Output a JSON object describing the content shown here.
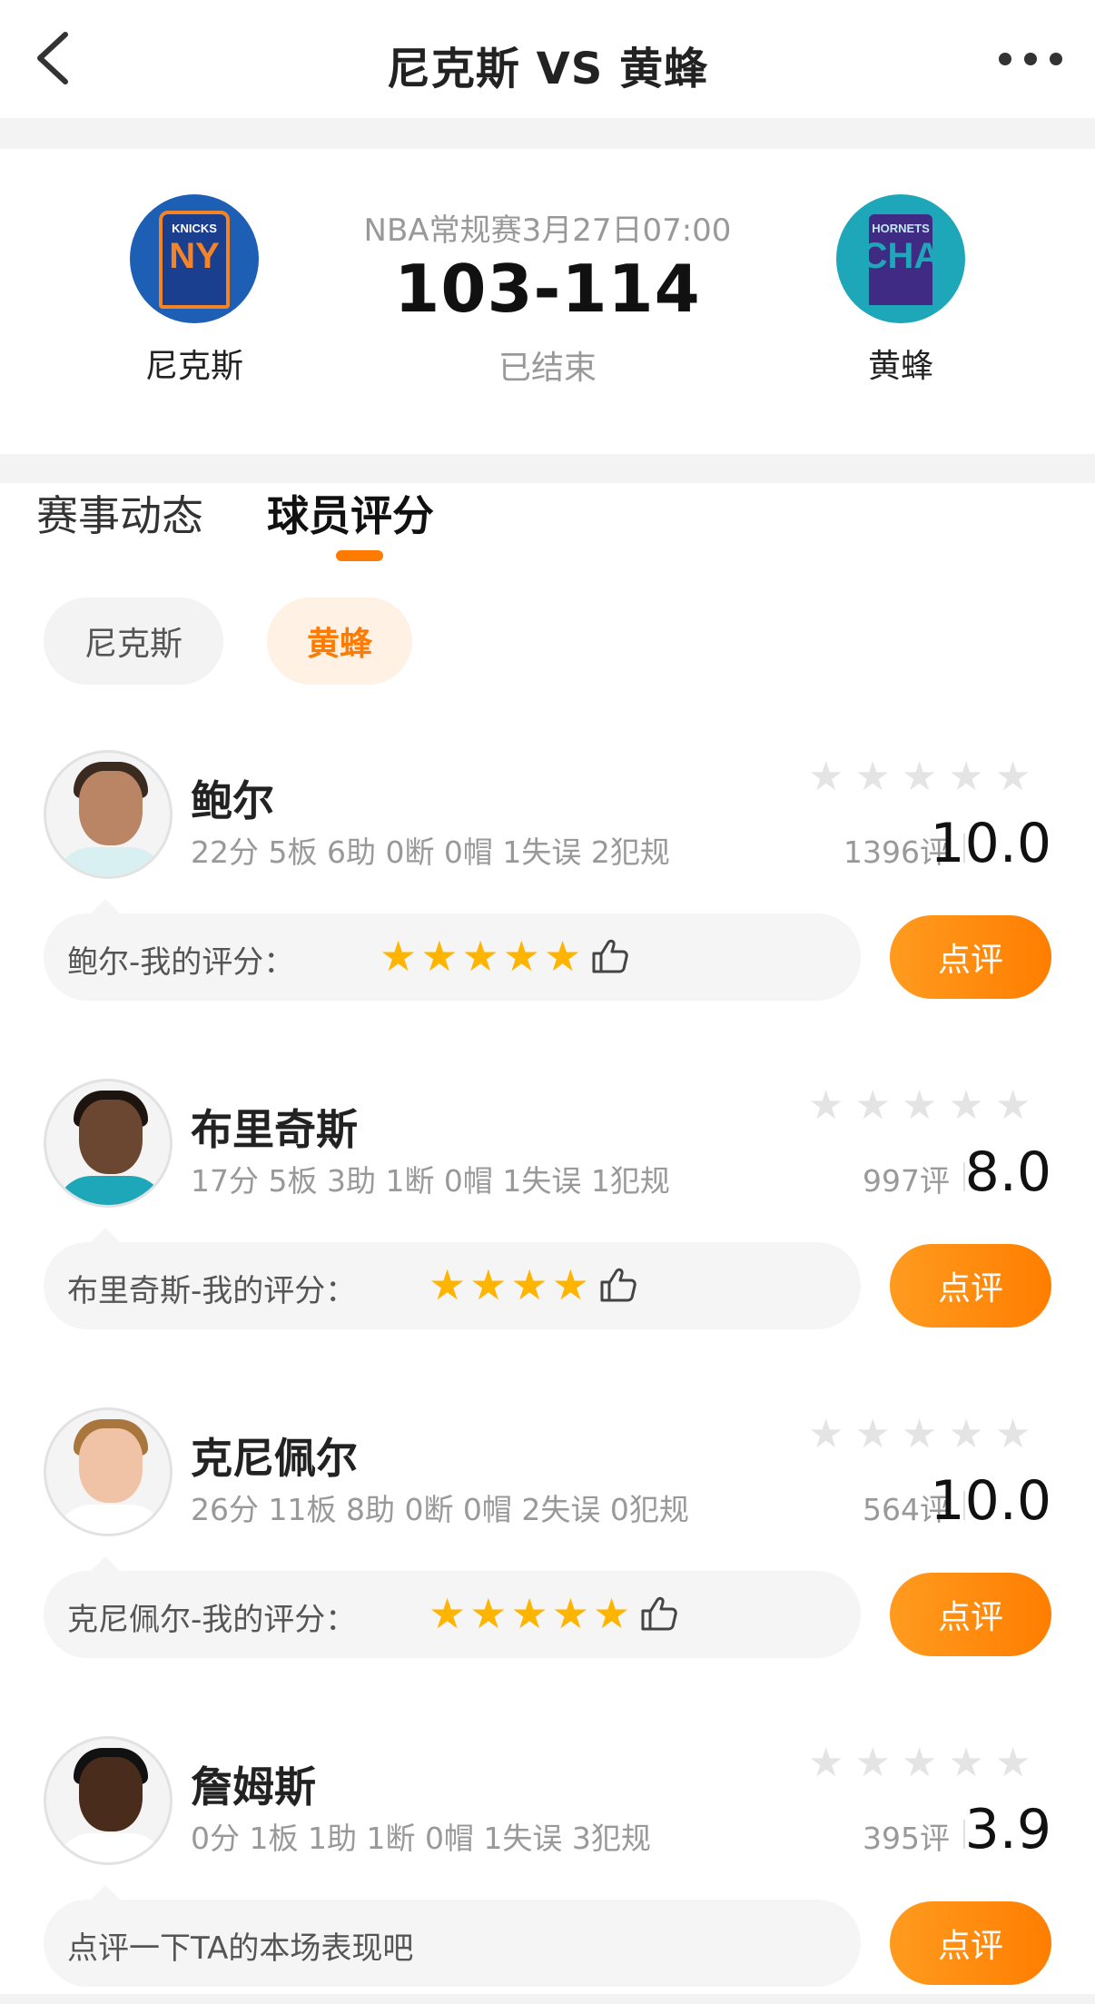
{
  "header": {
    "title": "尼克斯 VS 黄蜂"
  },
  "match": {
    "info": "NBA常规赛3月27日07:00",
    "score": "103-114",
    "status": "已结束",
    "home": {
      "name": "尼克斯",
      "logo_small": "KNICKS",
      "logo_big": "NY",
      "color": "#f58426"
    },
    "away": {
      "name": "黄蜂",
      "logo_small": "HORNETS",
      "logo_big": "CHA",
      "color": "#1ea7b8"
    }
  },
  "tabs": {
    "items": [
      {
        "label": "赛事动态",
        "active": false
      },
      {
        "label": "球员评分",
        "active": true
      }
    ]
  },
  "filters": {
    "items": [
      {
        "label": "尼克斯",
        "active": false
      },
      {
        "label": "黄蜂",
        "active": true
      }
    ]
  },
  "players": [
    {
      "name": "鲍尔",
      "stats": "22分 5板 6助 0断 0帽 1失误 2犯规",
      "rating_count": "1396评",
      "score": "10.0",
      "my_label": "鲍尔-我的评分：",
      "my_stars": 5,
      "button": "点评"
    },
    {
      "name": "布里奇斯",
      "stats": "17分 5板 3助 1断 0帽 1失误 1犯规",
      "rating_count": "997评",
      "score": "8.0",
      "my_label": "布里奇斯-我的评分：",
      "my_stars": 4,
      "button": "点评"
    },
    {
      "name": "克尼佩尔",
      "stats": "26分 11板 8助 0断 0帽 2失误 0犯规",
      "rating_count": "564评",
      "score": "10.0",
      "my_label": "克尼佩尔-我的评分：",
      "my_stars": 5,
      "button": "点评"
    },
    {
      "name": "詹姆斯",
      "stats": "0分 1板 1助 1断 0帽 1失误 3犯规",
      "rating_count": "395评",
      "score": "3.9",
      "my_label": "点评一下TA的本场表现吧",
      "my_stars": 0,
      "button": "点评"
    }
  ],
  "colors": {
    "accent": "#ff7a00",
    "star_gold": "#ffb400",
    "star_grey": "#e4e4e4"
  }
}
